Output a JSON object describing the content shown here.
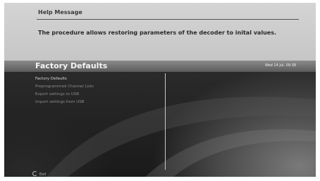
{
  "help": {
    "title": "Help Message",
    "text": "The procedure allows restoring parameters of the decoder to inital values."
  },
  "header": {
    "title": "Factory Defaults",
    "datetime": "Wed 14 Jul. 09:38"
  },
  "menu": {
    "items": [
      {
        "label": "Factory Defaults",
        "selected": true
      },
      {
        "label": "Preprogrammed Channel Lists",
        "selected": false
      },
      {
        "label": "Export settings to USB",
        "selected": false
      },
      {
        "label": "Import settings from USB",
        "selected": false
      }
    ]
  },
  "footer": {
    "exit_label": "Exit",
    "exit_icon": "exit-icon"
  }
}
